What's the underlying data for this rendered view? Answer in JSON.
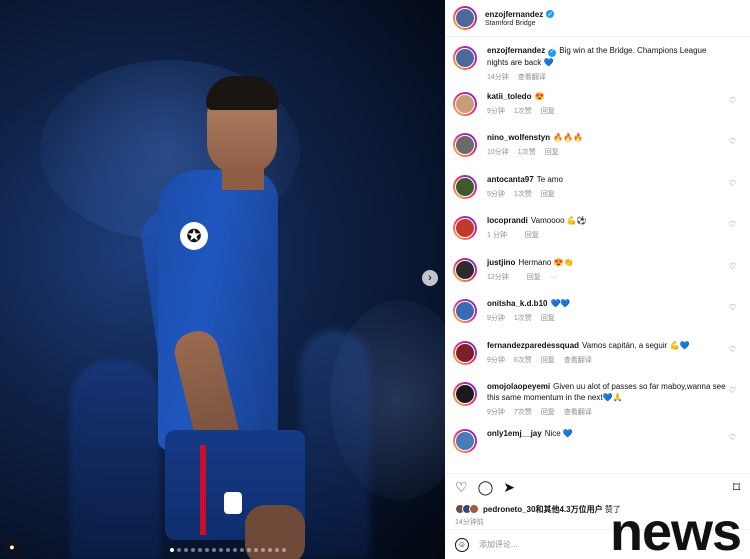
{
  "header": {
    "username": "enzojfernandez",
    "location": "Stamford Bridge"
  },
  "caption": {
    "username": "enzojfernandez",
    "text": "Big win at the Bridge. Champions League nights are back 💙",
    "time": "14分钟",
    "translate": "查看翻译"
  },
  "comments": [
    {
      "username": "katii_toledo",
      "text": "😍",
      "time": "9分钟",
      "likes": "1次赞",
      "reply": "回复",
      "extra": "",
      "color": "#c89b7b"
    },
    {
      "username": "nino_wolfenstyn",
      "text": "🔥🔥🔥",
      "time": "10分钟",
      "likes": "1次赞",
      "reply": "回复",
      "extra": "",
      "color": "#6a6a6a"
    },
    {
      "username": "antocanta97",
      "text": "Te amo",
      "time": "5分钟",
      "likes": "1次赞",
      "reply": "回复",
      "extra": "",
      "color": "#3c5a2e"
    },
    {
      "username": "locoprandi",
      "text": "Vamoooo 💪⚽",
      "time": "1 分钟",
      "likes": "",
      "reply": "回复",
      "extra": "",
      "color": "#c0392b"
    },
    {
      "username": "justjino",
      "text": "Hermano 😍👏",
      "time": "12分钟",
      "likes": "",
      "reply": "回复",
      "extra": "···",
      "color": "#2c2c2c"
    },
    {
      "username": "onitsha_k.d.b10",
      "text": "💙💙",
      "time": "9分钟",
      "likes": "1次赞",
      "reply": "回复",
      "extra": "",
      "color": "#3b6bb5"
    },
    {
      "username": "fernandezparedessquad",
      "text": "Vamos capitán, a seguir 💪💙",
      "time": "9分钟",
      "likes": "6次赞",
      "reply": "回复",
      "extra": "查看翻译",
      "color": "#7a1f2b"
    },
    {
      "username": "omojolaopeyemi",
      "text": "Given uu alot of passes so far maboy,wanna see this same momentum in the next💙🙏",
      "time": "9分钟",
      "likes": "7次赞",
      "reply": "回复",
      "extra": "查看翻译",
      "color": "#1a1a1a"
    },
    {
      "username": "only1emj__jay",
      "text": "Nice 💙",
      "time": "",
      "likes": "",
      "reply": "",
      "extra": "",
      "color": "#4a7ab8"
    }
  ],
  "actions": {
    "like_icon": "♡",
    "comment_icon": "◯",
    "share_icon": "➤",
    "save_icon": "⌑"
  },
  "likes": {
    "user": "pedroneto_30",
    "and_others": "和其他4.3万位用户",
    "suffix": "赞了"
  },
  "post_time": "14分钟前",
  "add_comment": {
    "emoji_icon": "☺",
    "placeholder": "添加评论..."
  },
  "watermark": "news",
  "photo": {
    "next_arrow": "›"
  }
}
